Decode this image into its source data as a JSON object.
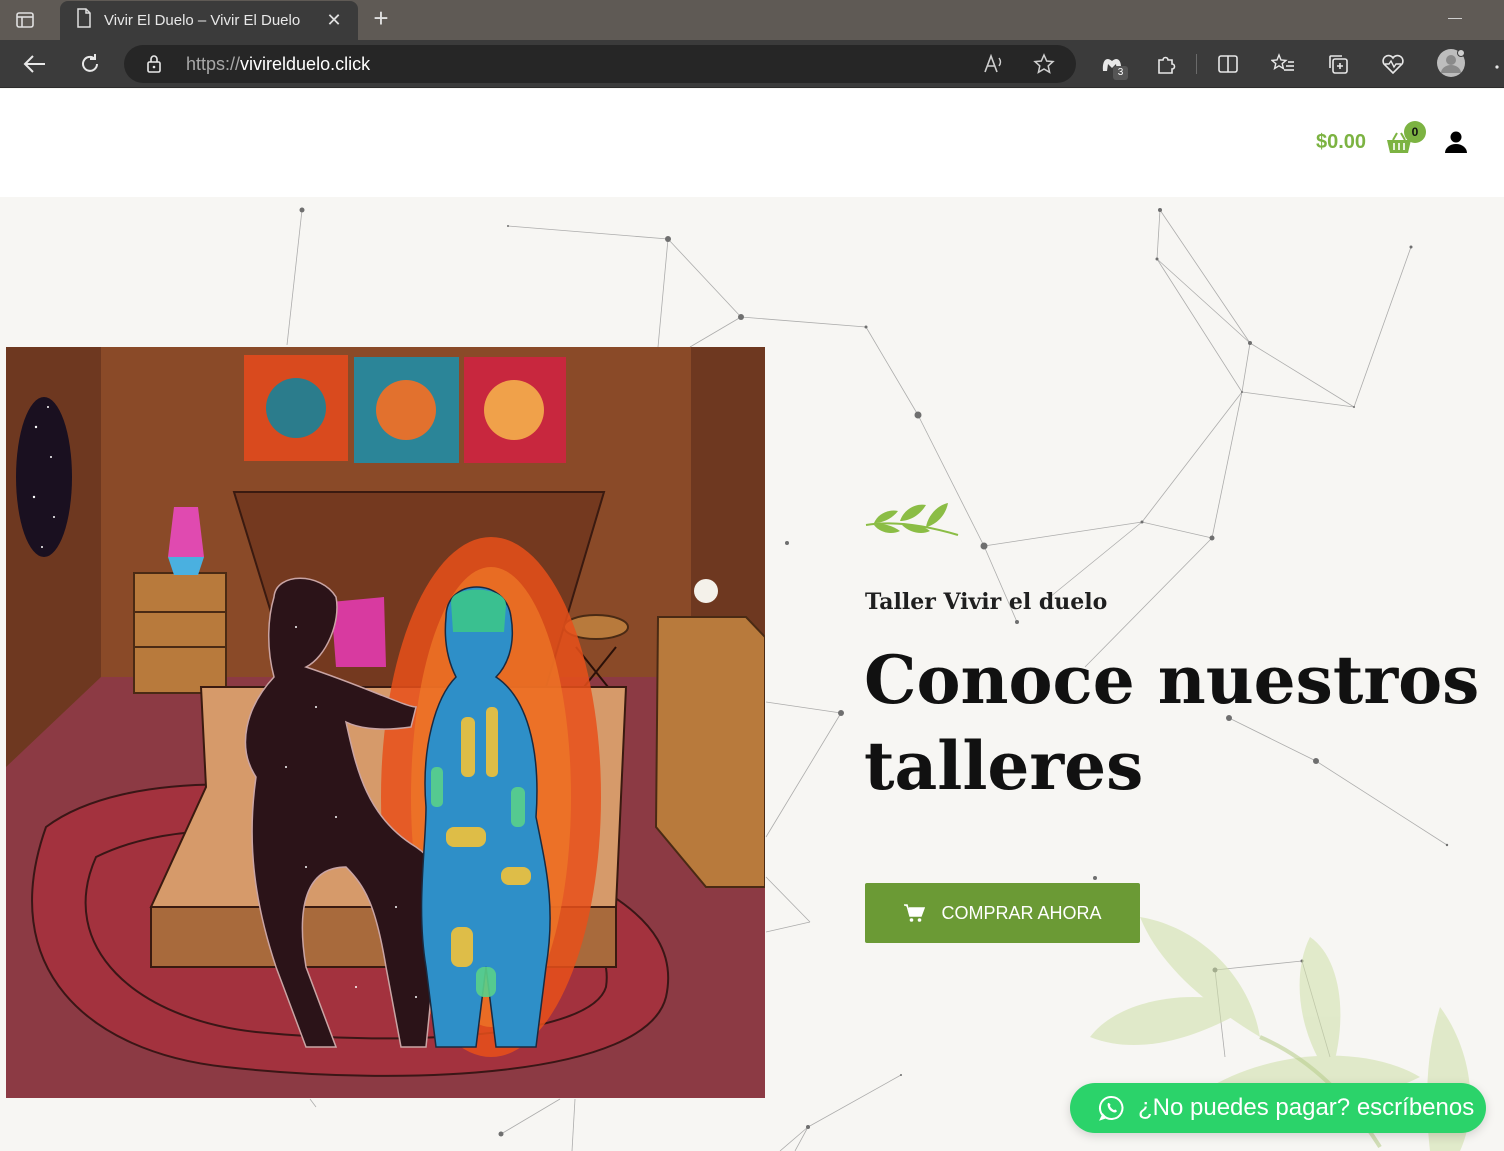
{
  "browser": {
    "tab_title": "Vivir El Duelo – Vivir El Duelo",
    "url_scheme": "https://",
    "url_host": "vivirelduelo.click",
    "extension_badge": "3"
  },
  "header": {
    "cart_total": "$0.00",
    "cart_count": "0"
  },
  "hero": {
    "eyebrow": "Taller Vivir el duelo",
    "headline": "Conoce nuestros talleres",
    "cta_label": "COMPRAR AHORA"
  },
  "whatsapp": {
    "label": "¿No puedes pagar? escríbenos"
  },
  "colors": {
    "brand_green": "#7cb342",
    "button_green": "#6b9a35",
    "whatsapp_green": "#2bd36a"
  }
}
